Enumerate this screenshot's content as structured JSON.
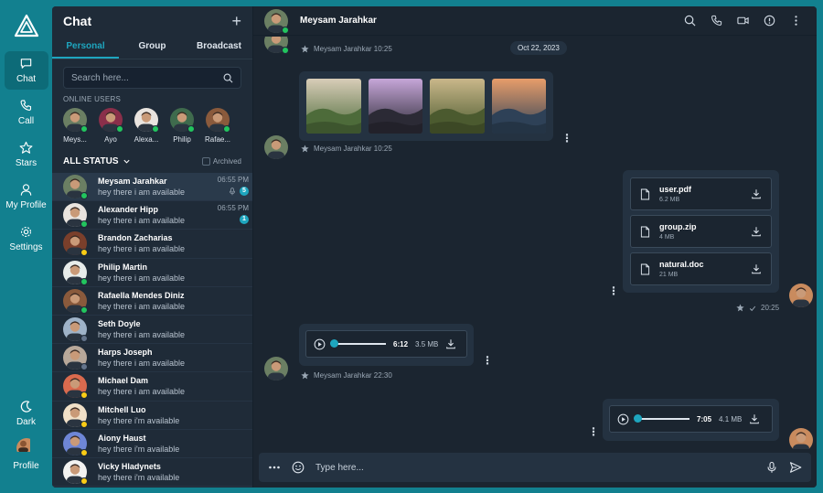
{
  "nav": {
    "items": [
      {
        "label": "Chat",
        "icon": "chat-icon",
        "active": true
      },
      {
        "label": "Call",
        "icon": "phone-icon",
        "active": false
      },
      {
        "label": "Stars",
        "icon": "star-icon",
        "active": false
      },
      {
        "label": "My Profile",
        "icon": "user-icon",
        "active": false
      },
      {
        "label": "Settings",
        "icon": "gear-icon",
        "active": false
      }
    ],
    "theme_label": "Dark",
    "profile_label": "Profile"
  },
  "sidebar": {
    "title": "Chat",
    "tabs": [
      "Personal",
      "Group",
      "Broadcast"
    ],
    "search_placeholder": "Search here...",
    "online_label": "ONLINE USERS",
    "online_users": [
      {
        "name": "Meys...",
        "tone": "#6b7f63"
      },
      {
        "name": "Ayo",
        "tone": "#8a2f4a"
      },
      {
        "name": "Alexa...",
        "tone": "#e9e4df"
      },
      {
        "name": "Philip",
        "tone": "#3f6b4d"
      },
      {
        "name": "Rafae...",
        "tone": "#8a5a3c"
      }
    ],
    "status_title": "ALL STATUS",
    "archived_label": "Archived",
    "chats": [
      {
        "name": "Meysam Jarahkar",
        "msg": "hey there i am available",
        "time": "06:55 PM",
        "badge": "5",
        "mic": true,
        "status": "green",
        "tone": "#6b7f63",
        "active": true
      },
      {
        "name": "Alexander Hipp",
        "msg": "hey there i am available",
        "time": "06:55 PM",
        "badge": "1",
        "mic": false,
        "status": "green",
        "tone": "#e9e4df",
        "active": false
      },
      {
        "name": "Brandon Zacharias",
        "msg": "hey there i am available",
        "time": "",
        "badge": "",
        "mic": false,
        "status": "yellow",
        "tone": "#7a3f2b",
        "active": false
      },
      {
        "name": "Philip Martin",
        "msg": "hey there i am available",
        "time": "",
        "badge": "",
        "mic": false,
        "status": "green",
        "tone": "#e7ecea",
        "active": false
      },
      {
        "name": "Rafaella Mendes Diniz",
        "msg": "hey there i am available",
        "time": "",
        "badge": "",
        "mic": false,
        "status": "green",
        "tone": "#8a5a3c",
        "active": false
      },
      {
        "name": "Seth Doyle",
        "msg": "hey there i am available",
        "time": "",
        "badge": "",
        "mic": false,
        "status": "gray",
        "tone": "#9fb3c8",
        "active": false
      },
      {
        "name": "Harps Joseph",
        "msg": "hey there i am available",
        "time": "",
        "badge": "",
        "mic": false,
        "status": "gray",
        "tone": "#b7a89a",
        "active": false
      },
      {
        "name": "Michael Dam",
        "msg": "hey there i am available",
        "time": "",
        "badge": "",
        "mic": false,
        "status": "yellow",
        "tone": "#d96a4e",
        "active": false
      },
      {
        "name": "Mitchell Luo",
        "msg": "hey there i'm available",
        "time": "",
        "badge": "",
        "mic": false,
        "status": "yellow",
        "tone": "#f0e0c8",
        "active": false
      },
      {
        "name": "Aiony Haust",
        "msg": "hey there i'm available",
        "time": "",
        "badge": "",
        "mic": false,
        "status": "yellow",
        "tone": "#6e86d6",
        "active": false
      },
      {
        "name": "Vicky Hladynets",
        "msg": "hey there i'm available",
        "time": "",
        "badge": "",
        "mic": false,
        "status": "yellow",
        "tone": "#f3f3f1",
        "active": false
      }
    ]
  },
  "conversation": {
    "contact_name": "Meysam Jarahkar",
    "date_pill": "Oct 22, 2023",
    "meta1": "Meysam Jarahkar 10:25",
    "meta2": "Meysam Jarahkar 10:25",
    "images": [
      {
        "sky": "#d8cdb8",
        "land": "#4d6b3a"
      },
      {
        "sky": "#c6a6d8",
        "land": "#2b2a35"
      },
      {
        "sky": "#c9b78a",
        "land": "#4b5a2f"
      },
      {
        "sky": "#e79d6a",
        "land": "#2e4157"
      }
    ],
    "files": [
      {
        "name": "user.pdf",
        "size": "6.2 MB"
      },
      {
        "name": "group.zip",
        "size": "4 MB"
      },
      {
        "name": "natural.doc",
        "size": "21 MB"
      }
    ],
    "sent_time": "20:25",
    "audio_in": {
      "duration": "6:12",
      "size": "3.5 MB"
    },
    "meta3": "Meysam Jarahkar 22:30",
    "audio_out": {
      "duration": "7:05",
      "size": "4.1 MB"
    },
    "composer_placeholder": "Type here..."
  },
  "colors": {
    "accent": "#1ea6bf",
    "nav": "#12808f",
    "panel": "#1f2b38",
    "online": "#22c55e",
    "away": "#facc15"
  }
}
